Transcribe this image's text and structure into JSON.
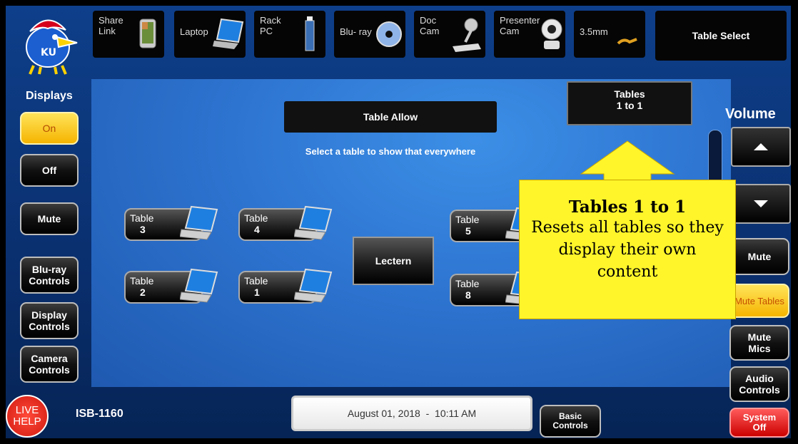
{
  "header": {
    "sources": [
      {
        "label": "Share\nLink",
        "icon": "phone-icon"
      },
      {
        "label": "Laptop",
        "icon": "laptop-icon"
      },
      {
        "label": "Rack\nPC",
        "icon": "pc-tower-icon"
      },
      {
        "label": "Blu- ray",
        "icon": "disc-icon"
      },
      {
        "label": "Doc\nCam",
        "icon": "document-camera-icon"
      },
      {
        "label": "Presenter\nCam",
        "icon": "camera-icon"
      },
      {
        "label": "3.5mm",
        "icon": "audio-jack-icon"
      }
    ],
    "table_select": "Table Select"
  },
  "left": {
    "displays_title": "Displays",
    "on": "On",
    "off": "Off",
    "mute": "Mute",
    "bluray_controls": "Blu-ray\nControls",
    "display_controls": "Display\nControls",
    "camera_controls": "Camera\nControls"
  },
  "main": {
    "table_allow": "Table Allow",
    "instruction": "Select a table to show that everywhere",
    "tables_1to1": "Tables\n1 to 1",
    "lectern": "Lectern",
    "tables": [
      {
        "word": "Table",
        "num": "3"
      },
      {
        "word": "Table",
        "num": "4"
      },
      {
        "word": "Table",
        "num": "2"
      },
      {
        "word": "Table",
        "num": "1"
      },
      {
        "word": "Table",
        "num": "5"
      },
      {
        "word": "Table",
        "num": "8"
      }
    ]
  },
  "callout": {
    "heading": "Tables 1 to 1",
    "body": "Resets all tables so they display their own content"
  },
  "right": {
    "volume": "Volume",
    "mute": "Mute",
    "mute_tables": "Mute Tables",
    "mute_mics": "Mute\nMics",
    "audio_controls": "Audio\nControls",
    "system_off": "System\nOff",
    "volume_level": 0.35
  },
  "footer": {
    "live_help": "LIVE\nHELP",
    "room": "ISB-1160",
    "datetime": "August 01, 2018  -  10:11 AM",
    "basic_controls": "Basic\nControls"
  },
  "colors": {
    "accent_yellow": "#f5b400",
    "panel_blue": "#2d74d0",
    "callout": "#fff52a",
    "red": "#cc0000"
  }
}
